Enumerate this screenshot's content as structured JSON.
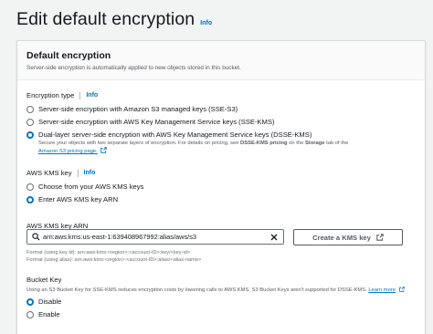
{
  "header": {
    "title": "Edit default encryption",
    "info": "Info"
  },
  "panel": {
    "title": "Default encryption",
    "description": "Server-side encryption is automatically applied to new objects stored in this bucket."
  },
  "encryption_type": {
    "label": "Encryption type",
    "info": "Info",
    "options": [
      {
        "label": "Server-side encryption with Amazon S3 managed keys (SSE-S3)",
        "selected": false
      },
      {
        "label": "Server-side encryption with AWS Key Management Service keys (SSE-KMS)",
        "selected": false
      },
      {
        "label": "Dual-layer server-side encryption with AWS Key Management Service keys (DSSE-KMS)",
        "selected": true
      }
    ],
    "dsse_desc_1": "Secure your objects with two separate layers of encryption. For details on pricing, see ",
    "dsse_desc_bold_1": "DSSE-KMS pricing",
    "dsse_desc_2": " on the ",
    "dsse_desc_bold_2": "Storage",
    "dsse_desc_3": " tab of the ",
    "dsse_desc_link": "Amazon S3 pricing page."
  },
  "kms_key": {
    "label": "AWS KMS key",
    "info": "Info",
    "options": [
      {
        "label": "Choose from your AWS KMS keys",
        "selected": false
      },
      {
        "label": "Enter AWS KMS key ARN",
        "selected": true
      }
    ]
  },
  "arn": {
    "label": "AWS KMS key ARN",
    "value": "arn:aws:kms:us-east-1:639408967992:alias/aws/s3",
    "create_button": "Create a KMS key",
    "format_1": "Format (using key id): arn:aws:kms:<region>:<account-ID>:key/<key-id>",
    "format_2": "Format (using alias): arn:aws:kms:<region>:<account-ID>:alias/<alias-name>"
  },
  "bucket_key": {
    "label": "Bucket Key",
    "desc": "Using an S3 Bucket Key for SSE-KMS reduces encryption costs by lowering calls to AWS KMS. S3 Bucket Keys aren't supported for DSSE-KMS.",
    "learn_more": "Learn more",
    "options": [
      {
        "label": "Disable",
        "selected": true
      },
      {
        "label": "Enable",
        "selected": false
      }
    ]
  },
  "colors": {
    "accent": "#0073bb",
    "text": "#16191f",
    "muted": "#545b64"
  }
}
